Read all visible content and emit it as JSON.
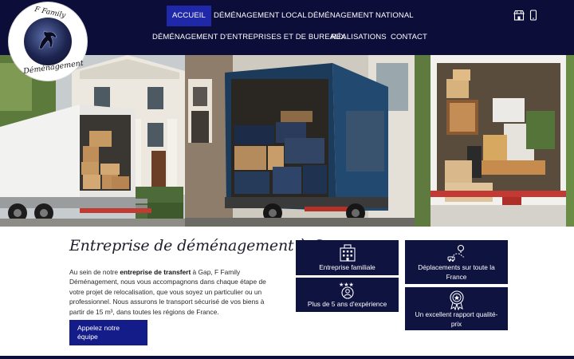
{
  "logo": {
    "top_text": "F Family",
    "bottom_text": "Déménagement"
  },
  "nav": {
    "items": [
      {
        "label": "Accueil",
        "active": true
      },
      {
        "label": "Déménagement local"
      },
      {
        "label": "Déménagement national"
      },
      {
        "label": "Déménagement d'entreprises et de bureaux"
      },
      {
        "label": "Réalisations"
      },
      {
        "label": "Contact"
      }
    ],
    "icons": [
      "store-icon",
      "phone-icon"
    ]
  },
  "hero": {
    "panels": [
      "truck-house-panel",
      "truck-boxes-panel",
      "truck-furniture-panel"
    ]
  },
  "main": {
    "title": "Entreprise de déménagement à Gap",
    "desc_before": "Au sein de notre ",
    "desc_bold": "entreprise de transfert",
    "desc_after": " à Gap, F Family Déménagement, nous vous accompagnons dans chaque étape de votre projet de relocalisation, que vous soyez un particulier ou un professionnel. Nous assurons le transport sécurisé de vos biens à partir de 15 m³, dans toutes les régions de France.",
    "cta_label": "Appelez notre équipe"
  },
  "features": [
    {
      "label": "Entreprise familiale",
      "icon": "building-icon"
    },
    {
      "label": "Déplacements sur toute la France",
      "icon": "route-icon"
    },
    {
      "label": "Plus de 5 ans d'expérience",
      "icon": "stars-user-icon"
    },
    {
      "label": "Un excellent rapport qualité-prix",
      "icon": "award-icon"
    }
  ],
  "colors": {
    "header": "#0d0d3a",
    "active_nav": "#1f28a8",
    "card": "#0f1340",
    "cta": "#141c8a"
  }
}
